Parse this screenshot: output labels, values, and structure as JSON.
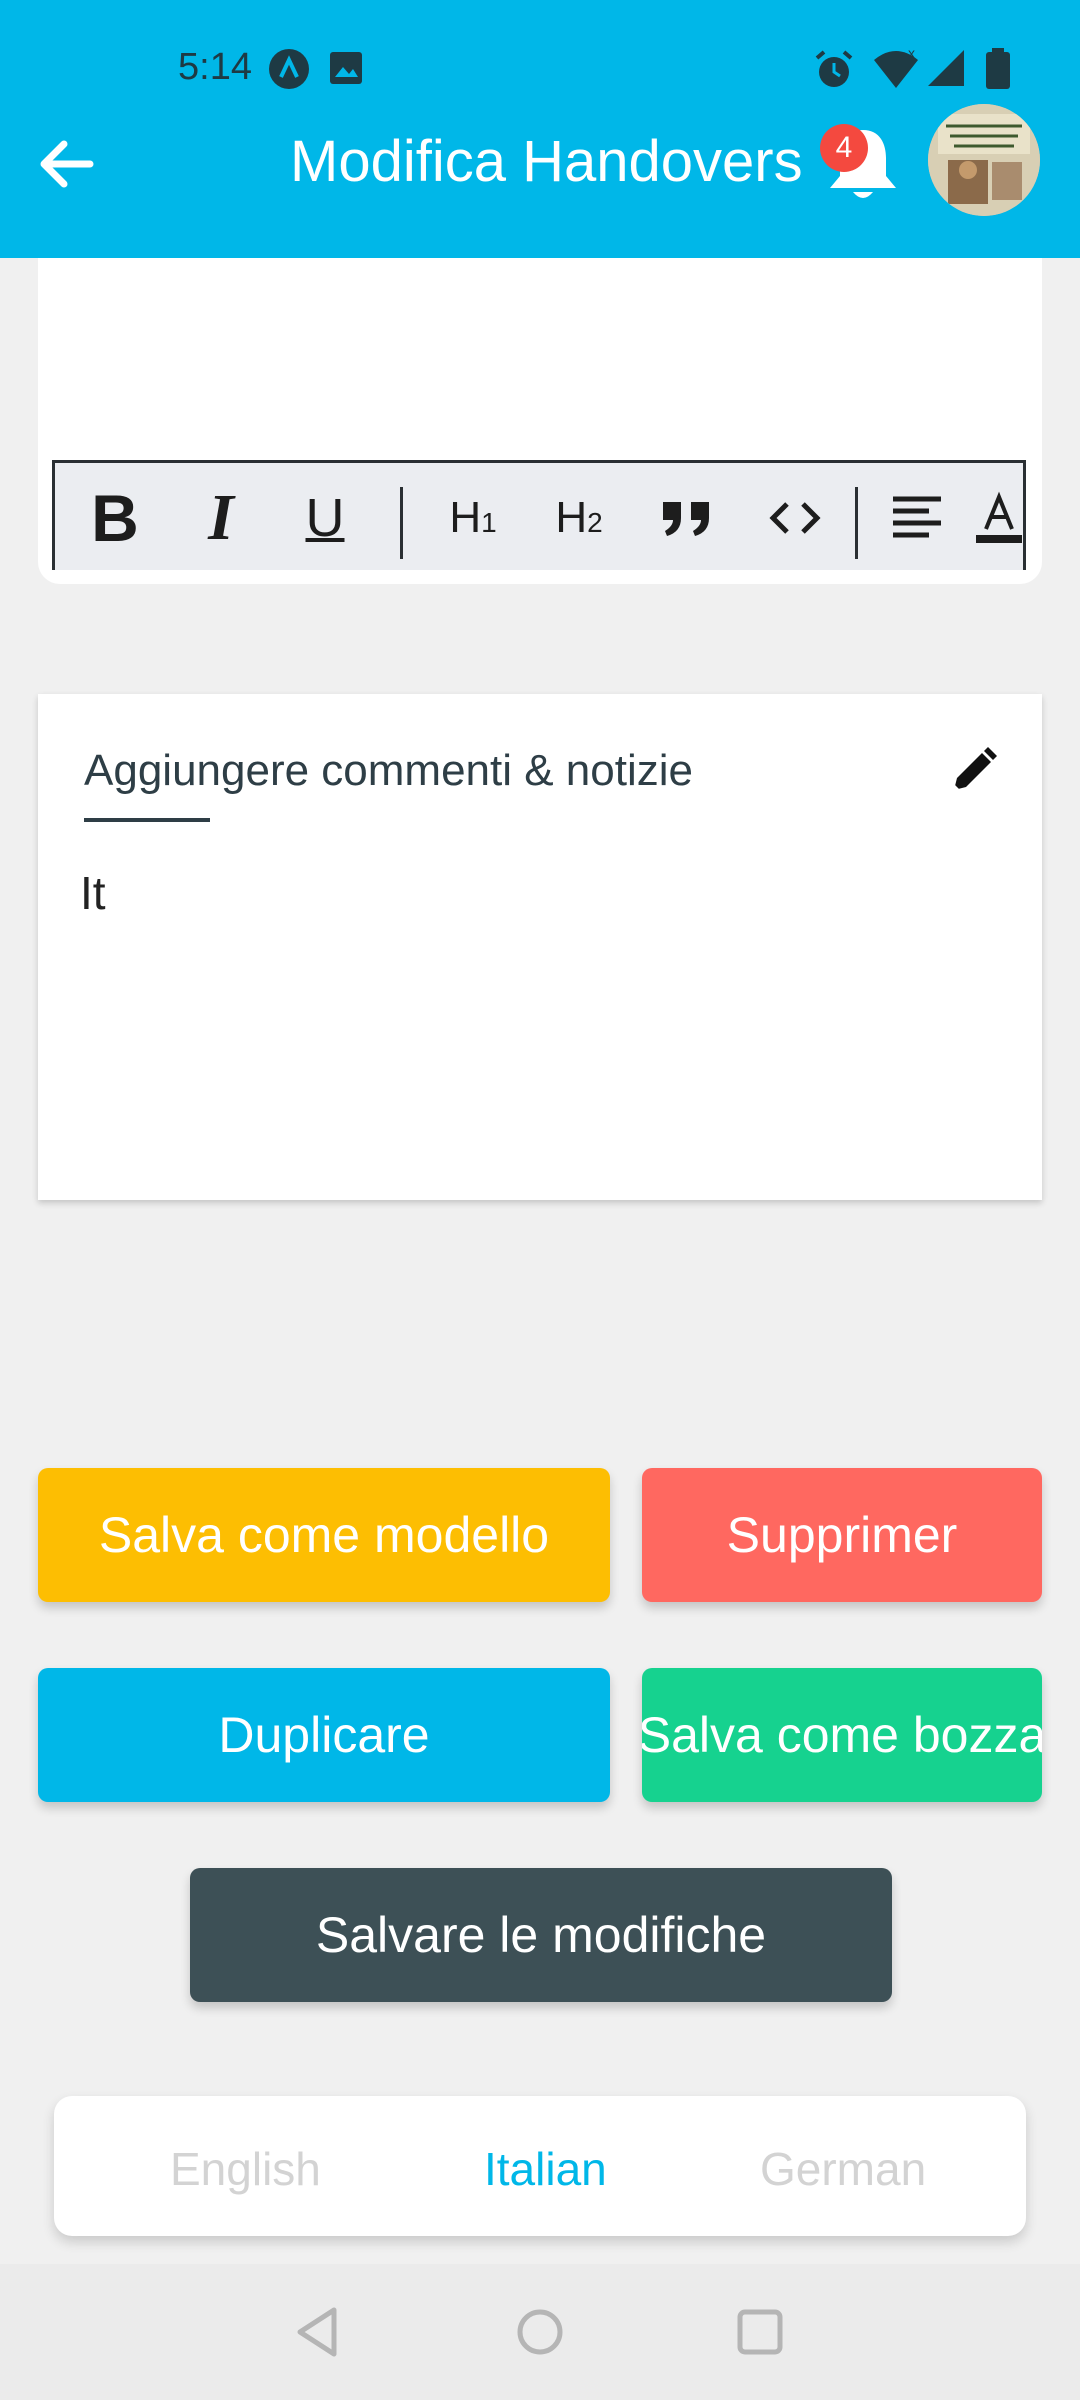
{
  "status_bar": {
    "time": "5:14",
    "icons": [
      "a-logo-icon",
      "image-icon",
      "alarm-icon",
      "wifi-icon",
      "signal-icon",
      "battery-icon"
    ]
  },
  "app_bar": {
    "title": "Modifica Handovers",
    "notification_count": "4",
    "back_icon": "arrow-left-icon",
    "bell_icon": "bell-icon"
  },
  "editor": {
    "toolbar": [
      {
        "name": "bold",
        "label": "B"
      },
      {
        "name": "italic",
        "label": "I"
      },
      {
        "name": "underline",
        "label": "U"
      },
      {
        "name": "heading-1",
        "label": "H",
        "sub": "1"
      },
      {
        "name": "heading-2",
        "label": "H",
        "sub": "2"
      },
      {
        "name": "blockquote",
        "label": "❞"
      },
      {
        "name": "code",
        "label": "<>"
      },
      {
        "name": "align-left",
        "label": "≡"
      },
      {
        "name": "text-color",
        "label": "A"
      }
    ]
  },
  "comments": {
    "title": "Aggiungere commenti & notizie",
    "body": "It",
    "edit_icon": "pencil-icon"
  },
  "actions": {
    "save_template": "Salva come modello",
    "delete": "Supprimer",
    "duplicate": "Duplicare",
    "save_draft": "Salva come bozza",
    "save_changes": "Salvare le modifiche"
  },
  "languages": {
    "items": [
      "English",
      "Italian",
      "German"
    ],
    "selected": "Italian"
  },
  "colors": {
    "primary": "#00b7e8",
    "template": "#fdbe02",
    "delete": "#ff6860",
    "draft": "#16d28f",
    "save": "#3d5056"
  }
}
